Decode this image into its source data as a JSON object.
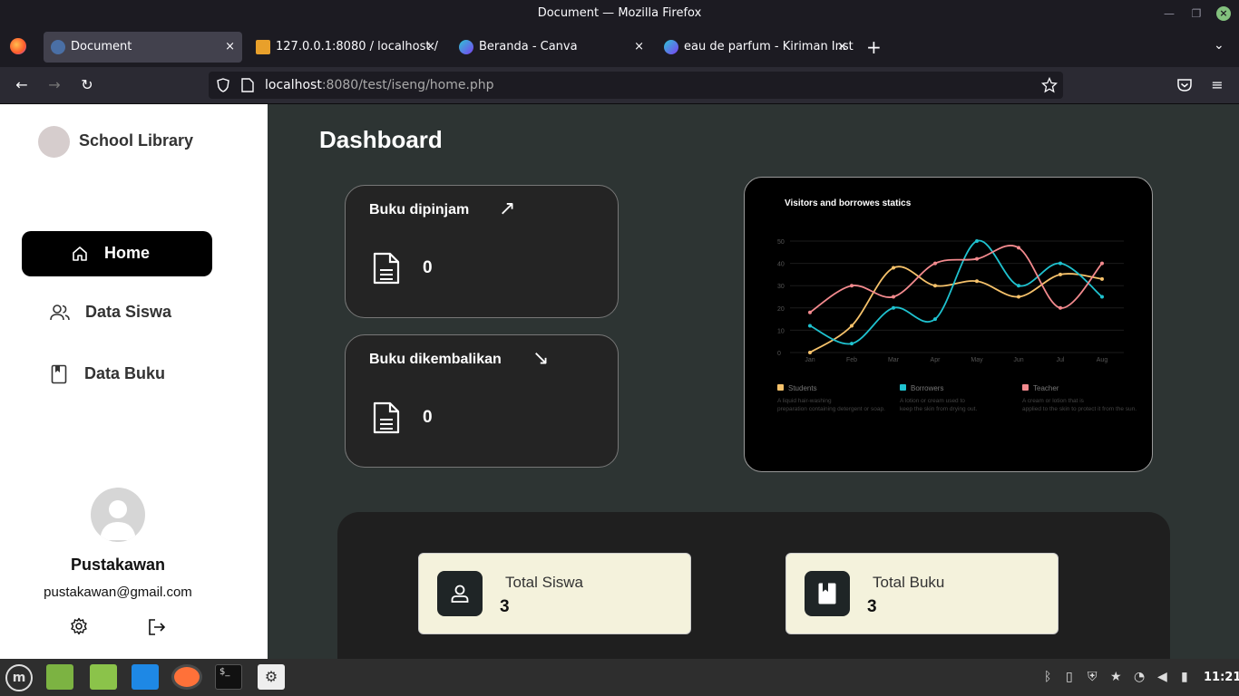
{
  "window": {
    "title": "Document — Mozilla Firefox"
  },
  "tabs": [
    {
      "label": "Document"
    },
    {
      "label": "127.0.0.1:8080 / localhost / ..."
    },
    {
      "label": "Beranda - Canva"
    },
    {
      "label": "eau de parfum - Kiriman Inst"
    }
  ],
  "url": {
    "host": "localhost",
    "rest": ":8080/test/iseng/home.php"
  },
  "sidebar": {
    "brand": "School Library",
    "menu": [
      {
        "label": "Home",
        "icon": "home-icon"
      },
      {
        "label": "Data Siswa",
        "icon": "users-icon"
      },
      {
        "label": "Data Buku",
        "icon": "book-icon"
      }
    ],
    "user": {
      "name": "Pustakawan",
      "email": "pustakawan@gmail.com"
    }
  },
  "main": {
    "title": "Dashboard",
    "cards": [
      {
        "title": "Buku dipinjam",
        "value": "0",
        "arrow": "↗"
      },
      {
        "title": "Buku dikembalikan",
        "value": "0",
        "arrow": "↘"
      }
    ],
    "stats": [
      {
        "label": "Total Siswa",
        "value": "3"
      },
      {
        "label": "Total Buku",
        "value": "3"
      }
    ]
  },
  "chart_data": {
    "type": "line",
    "title": "Visitors and borrowes statics",
    "categories": [
      "Jan",
      "Feb",
      "Mar",
      "Apr",
      "May",
      "Jun",
      "Jul",
      "Aug"
    ],
    "ylim": [
      0,
      50
    ],
    "yticks": [
      "0",
      "10",
      "20",
      "30",
      "40",
      "50"
    ],
    "series": [
      {
        "name": "Students",
        "color": "#f6c26b",
        "values": [
          0,
          12,
          38,
          30,
          32,
          25,
          35,
          33
        ],
        "desc": "A liquid hair-washing preparation containing detergent or soap."
      },
      {
        "name": "Borrowers",
        "color": "#1fc2cf",
        "values": [
          12,
          4,
          20,
          15,
          50,
          30,
          40,
          25
        ],
        "desc": "A lotion or cream used to keep the skin from drying out."
      },
      {
        "name": "Teacher",
        "color": "#f38a8e",
        "values": [
          18,
          30,
          25,
          40,
          42,
          47,
          20,
          40
        ],
        "desc": "A cream or lotion that is applied to the skin to protect it from the sun."
      }
    ]
  },
  "taskbar": {
    "clock": "11:21"
  }
}
